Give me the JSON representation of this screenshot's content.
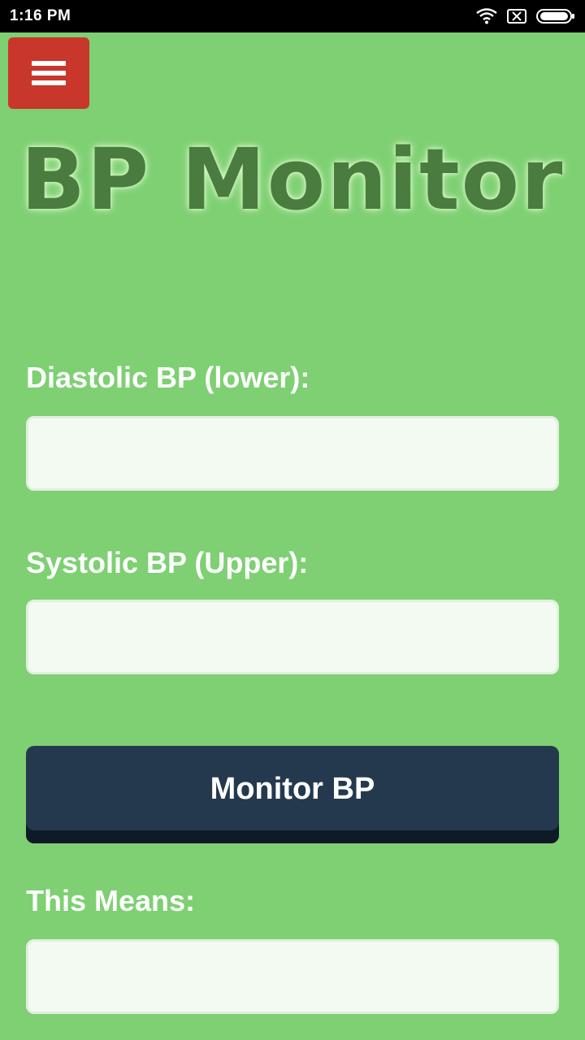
{
  "status_bar": {
    "time": "1:16 PM",
    "icons": [
      "wifi-icon",
      "sim-x-icon",
      "battery-icon"
    ]
  },
  "menu": {
    "icon": "hamburger-icon",
    "color": "#c9362b"
  },
  "app": {
    "title": "BP Monitor",
    "background_color": "#7ed073",
    "title_color": "#4a7c40"
  },
  "form": {
    "diastolic_label": "Diastolic BP (lower):",
    "diastolic_value": "",
    "systolic_label": "Systolic BP (Upper):",
    "systolic_value": "",
    "submit_label": "Monitor BP",
    "submit_color": "#24394e",
    "result_label": "This Means:",
    "result_value": ""
  }
}
